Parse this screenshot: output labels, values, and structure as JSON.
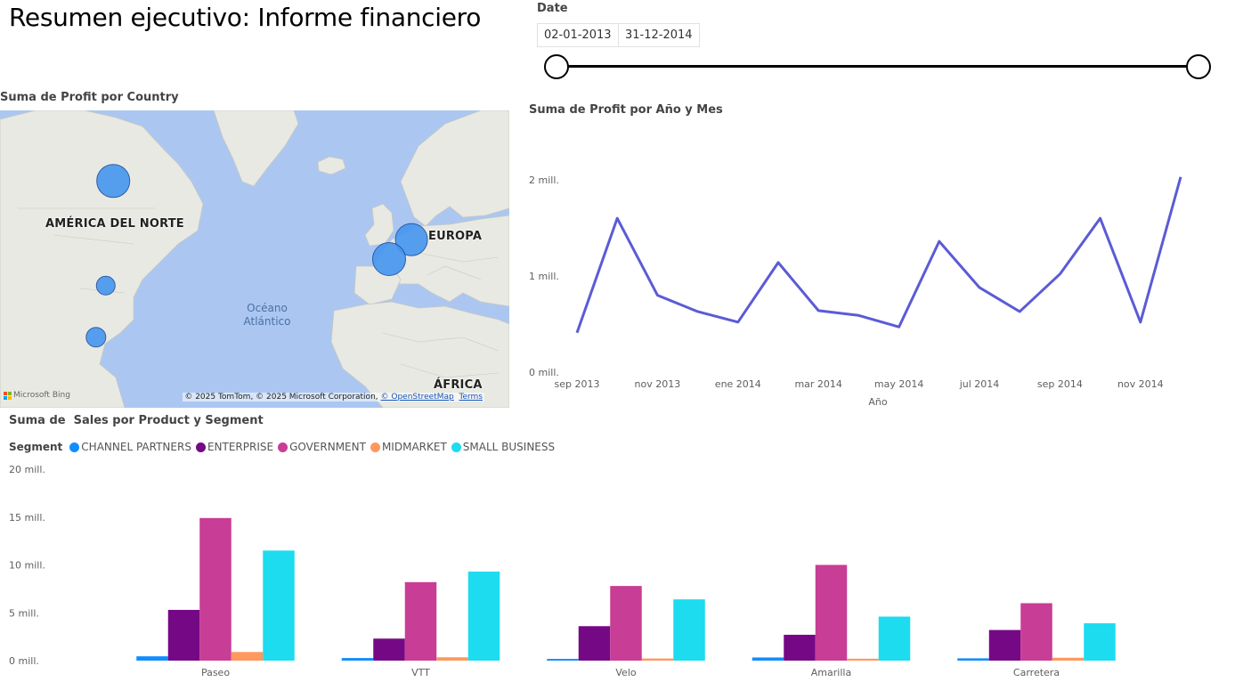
{
  "page": {
    "title": "Resumen ejecutivo: Informe financiero"
  },
  "date_slicer": {
    "label": "Date",
    "start": "02-01-2013",
    "end": "31-12-2014",
    "range_fraction": [
      0,
      1
    ]
  },
  "map_visual": {
    "title": "Suma de Profit por Country",
    "labels": {
      "north_america": "AMÉRICA DEL NORTE",
      "europe": "EUROPA",
      "africa": "ÁFRICA",
      "ocean_line1": "Océano",
      "ocean_line2": "Atlántico"
    },
    "attribution": {
      "bing": "Microsoft Bing",
      "copyright": "© 2025 TomTom, © 2025 Microsoft Corporation, ",
      "osm": "© OpenStreetMap",
      "terms": "Terms"
    },
    "bubbles": [
      {
        "country": "Canada",
        "relative_size": 0.98
      },
      {
        "country": "Germany",
        "relative_size": 0.94
      },
      {
        "country": "France",
        "relative_size": 1.0
      },
      {
        "country": "United States of America",
        "relative_size": 0.35
      },
      {
        "country": "Mexico",
        "relative_size": 0.38
      }
    ],
    "colors": {
      "bubble": "#4696f0",
      "water": "#abc7f1",
      "land": "#e9e9e3"
    }
  },
  "chart_data": [
    {
      "type": "line",
      "title": "Suma de Profit por Año y Mes",
      "xlabel": "Año",
      "ylabel": "",
      "color": "#5b5bd6",
      "x": [
        "sep 2013",
        "oct 2013",
        "nov 2013",
        "dic 2013",
        "ene 2014",
        "feb 2014",
        "mar 2014",
        "abr 2014",
        "may 2014",
        "jun 2014",
        "jul 2014",
        "ago 2014",
        "sep 2014",
        "oct 2014",
        "nov 2014",
        "dic 2014"
      ],
      "values": [
        0.41,
        1.6,
        0.8,
        0.63,
        0.52,
        1.14,
        0.64,
        0.59,
        0.47,
        1.36,
        0.88,
        0.63,
        1.02,
        1.6,
        0.52,
        2.03
      ],
      "x_tick_labels": [
        "sep 2013",
        "nov 2013",
        "ene 2014",
        "mar 2014",
        "may 2014",
        "jul 2014",
        "sep 2014",
        "nov 2014"
      ],
      "y_ticks": [
        0,
        1,
        2
      ],
      "y_tick_labels": [
        "0 mill.",
        "1 mill.",
        "2 mill."
      ],
      "ylim": [
        0,
        2.1
      ],
      "grid": false
    },
    {
      "type": "bar",
      "title": "Suma de  Sales por Product y Segment",
      "xlabel": "",
      "ylabel": "",
      "legend_title": "Segment",
      "legend_position": "top-left",
      "categories": [
        "Paseo",
        "VTT",
        "Velo",
        "Amarilla",
        "Carretera"
      ],
      "series": [
        {
          "name": "CHANNEL PARTNERS",
          "color": "#118dff",
          "values": [
            0.45,
            0.27,
            0.18,
            0.33,
            0.24
          ]
        },
        {
          "name": "ENTERPRISE",
          "color": "#750985",
          "values": [
            5.3,
            2.3,
            3.6,
            2.7,
            3.2
          ]
        },
        {
          "name": "GOVERNMENT",
          "color": "#c83d95",
          "values": [
            14.9,
            8.2,
            7.8,
            10.0,
            6.0
          ]
        },
        {
          "name": "MIDMARKET",
          "color": "#ff985e",
          "values": [
            0.9,
            0.35,
            0.22,
            0.2,
            0.3
          ]
        },
        {
          "name": "SMALL BUSINESS",
          "color": "#1ddcef",
          "values": [
            11.5,
            9.3,
            6.4,
            4.6,
            3.9
          ]
        }
      ],
      "y_ticks": [
        0,
        5,
        10,
        15,
        20
      ],
      "y_tick_labels": [
        "0 mill.",
        "5 mill.",
        "10 mill.",
        "15 mill.",
        "20 mill."
      ],
      "ylim": [
        0,
        20
      ],
      "grid": false
    }
  ]
}
